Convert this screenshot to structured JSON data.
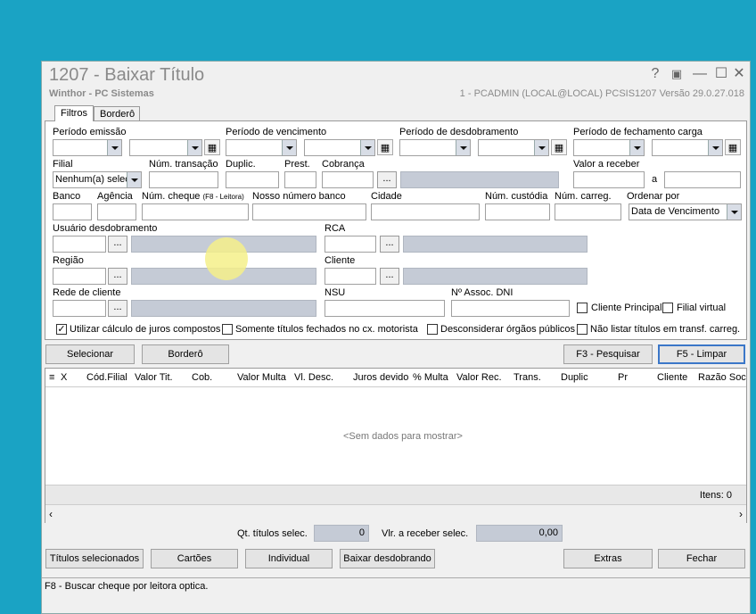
{
  "window": {
    "title": "1207 - Baixar Título",
    "subtitle": "Winthor - PC Sistemas",
    "system_info": "1 - PCADMIN (LOCAL@LOCAL)   PCSIS1207   Versão  29.0.27.018",
    "help_label": "?",
    "restore_label": "▣",
    "minimize_label": "—",
    "maximize_label": "☐",
    "close_label": "✕"
  },
  "tabs": [
    {
      "label": "Filtros"
    },
    {
      "label": "Borderô"
    }
  ],
  "filters": {
    "periodo_emissao": "Período emissão",
    "periodo_vencimento": "Período de vencimento",
    "periodo_desdobramento": "Período de desdobramento",
    "periodo_fechamento": "Período de fechamento carga",
    "filial": "Filial",
    "filial_value": "Nenhum(a) selec",
    "num_transacao": "Núm. transação",
    "duplic": "Duplic.",
    "prest": "Prest.",
    "cobranca": "Cobrança",
    "valor_receber": "Valor a receber",
    "valor_a": "a",
    "banco": "Banco",
    "agencia": "Agência",
    "num_cheque": "Núm. cheque",
    "num_cheque_hint": "(F8 - Leitora)",
    "nosso_numero": "Nosso número banco",
    "cidade": "Cidade",
    "num_custodia": "Núm. custódia",
    "num_carreg": "Núm. carreg.",
    "ordenar_por": "Ordenar por",
    "ordenar_value": "Data de Vencimento",
    "usuario_desdobramento": "Usuário desdobramento",
    "rca": "RCA",
    "regiao": "Região",
    "cliente": "Cliente",
    "rede_cliente": "Rede de cliente",
    "nsu": "NSU",
    "assoc_dni": "Nº Assoc. DNI",
    "cliente_principal": "Cliente Principal",
    "filial_virtual": "Filial virtual",
    "juros_compostos": "Utilizar cálculo de juros compostos",
    "somente_fechados": "Somente títulos fechados no cx. motorista",
    "desconsiderar_orgaos": "Desconsiderar órgãos públicos",
    "nao_listar": "Não listar títulos em transf. carreg.",
    "dots": "..."
  },
  "buttons": {
    "selecionar": "Selecionar",
    "bordero": "Borderô",
    "pesquisar": "F3 - Pesquisar",
    "limpar": "F5 - Limpar",
    "titulos_selecionados": "Títulos selecionados",
    "cartoes": "Cartões",
    "individual": "Individual",
    "baixar_desdobrando": "Baixar desdobrando",
    "extras": "Extras",
    "fechar": "Fechar"
  },
  "grid": {
    "columns": [
      "X",
      "Cód.Filial",
      "Valor Tit.",
      "Cob.",
      "Valor Multa",
      "Vl. Desc.",
      "Juros devido",
      "% Multa",
      "Valor Rec.",
      "Trans.",
      "Duplic",
      "Pr",
      "Cliente",
      "Razão Social"
    ],
    "empty_text": "<Sem dados para mostrar>",
    "items_label": "Itens: 0",
    "menu_icon": "≡"
  },
  "totals": {
    "qt_label": "Qt. títulos selec.",
    "qt_value": "0",
    "vlr_label": "Vlr. a receber selec.",
    "vlr_value": "0,00"
  },
  "status_bar": "F8 - Buscar cheque por leitora optica.",
  "colors": {
    "desktop": "#1aa3c4",
    "readonly": "#c5cbd6",
    "accent": "#3b77c8",
    "cursor": "#f5f08a"
  }
}
